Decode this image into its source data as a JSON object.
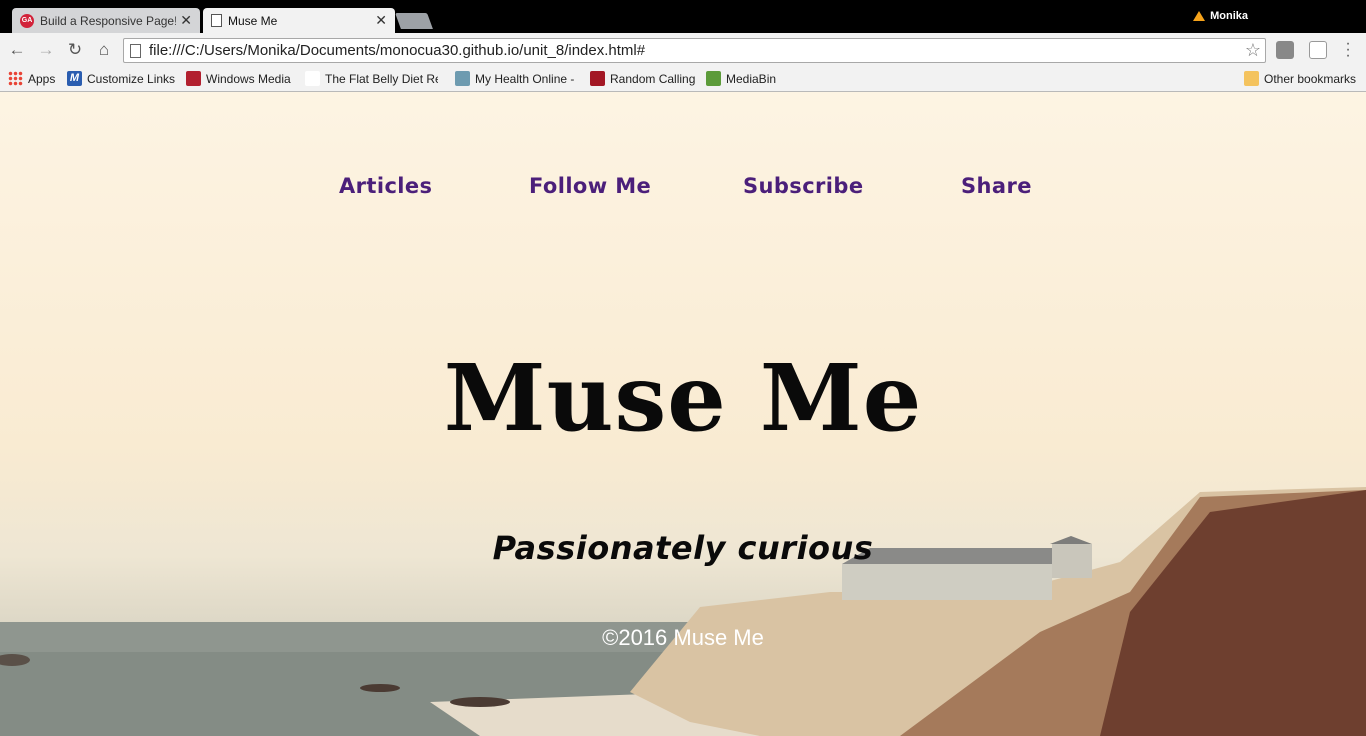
{
  "browser": {
    "tabs": [
      {
        "title": "Build a Responsive Page!",
        "favicon": "ga-icon"
      },
      {
        "title": "Muse Me",
        "favicon": "page-icon"
      }
    ],
    "close_glyph": "✕",
    "profile_name": "Monika",
    "url": "file:///C:/Users/Monika/Documents/monocua30.github.io/unit_8/index.html#",
    "bookmarks": [
      {
        "label": "Apps",
        "icon": "apps-icon"
      },
      {
        "label": "Customize Links",
        "icon": "customize-links-icon"
      },
      {
        "label": "Windows Media",
        "icon": "windows-media-icon"
      },
      {
        "label": "The Flat Belly Diet Rev",
        "icon": "webmd-icon"
      },
      {
        "label": "My Health Online -",
        "icon": "health-icon"
      },
      {
        "label": "Random Calling",
        "icon": "apple-icon"
      },
      {
        "label": "MediaBin",
        "icon": "mediabin-icon"
      }
    ],
    "other_bookmarks": "Other bookmarks"
  },
  "page": {
    "nav": [
      "Articles",
      "Follow Me",
      "Subscribe",
      "Share"
    ],
    "title": "Muse Me",
    "tagline": "Passionately curious",
    "footer": "©2016 Muse Me"
  },
  "colors": {
    "nav_link": "#4b1f7a",
    "title": "#0a0a0a",
    "footer_text": "#ffffff",
    "chrome_bg": "#f2f2f2"
  }
}
